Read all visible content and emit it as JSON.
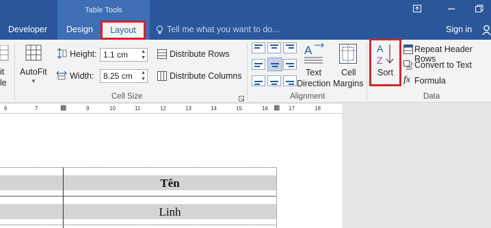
{
  "title_bar": {
    "context_label": "Table Tools",
    "tabs": [
      {
        "label": "Developer"
      },
      {
        "label": "Design"
      },
      {
        "label": "Layout"
      }
    ],
    "tell_me_placeholder": "Tell me what you want to do...",
    "sign_in_label": "Sign in"
  },
  "ribbon": {
    "partial_left": {
      "line1": "it",
      "line2": "le"
    },
    "cell_size": {
      "autofit_label": "AutoFit",
      "height_label": "Height:",
      "height_value": "1.1 cm",
      "width_label": "Width:",
      "width_value": "8.25 cm",
      "distribute_rows_label": "Distribute Rows",
      "distribute_columns_label": "Distribute Columns",
      "group_label": "Cell Size"
    },
    "alignment": {
      "text_direction_line1": "Text",
      "text_direction_line2": "Direction",
      "cell_margins_line1": "Cell",
      "cell_margins_line2": "Margins",
      "group_label": "Alignment"
    },
    "data": {
      "sort_label": "Sort",
      "repeat_header_rows_label": "Repeat Header Rows",
      "convert_to_text_label": "Convert to Text",
      "formula_label": "Formula",
      "group_label": "Data"
    }
  },
  "ruler": {
    "ticks": [
      "6",
      "7",
      "9",
      "10",
      "11",
      "12",
      "13",
      "14",
      "15",
      "16",
      "17",
      "18"
    ]
  },
  "document": {
    "table_header": "Tên",
    "table_row1": "Linh"
  },
  "colors": {
    "accent": "#2b579a",
    "highlight_box": "#d9202a",
    "ribbon_bg": "#f3f3f3"
  }
}
